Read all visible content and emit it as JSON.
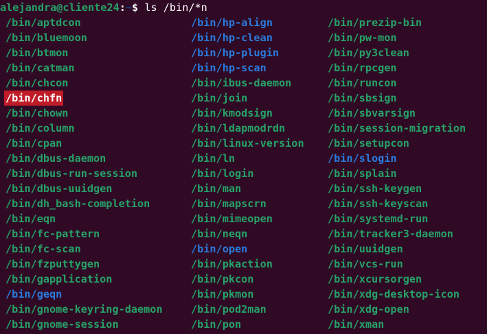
{
  "prompt": {
    "user_host": "alejandra@cliente24",
    "colon": ":",
    "path": "~",
    "dollar": "$",
    "command": " ls /bin/*n"
  },
  "columns": [
    [
      {
        "text": "/bin/aptdcon",
        "kind": "exec"
      },
      {
        "text": "/bin/bluemoon",
        "kind": "exec"
      },
      {
        "text": "/bin/btmon",
        "kind": "exec"
      },
      {
        "text": "/bin/catman",
        "kind": "exec"
      },
      {
        "text": "/bin/chcon",
        "kind": "exec"
      },
      {
        "text": "/bin/chfn",
        "kind": "setuid"
      },
      {
        "text": "/bin/chown",
        "kind": "exec"
      },
      {
        "text": "/bin/column",
        "kind": "exec"
      },
      {
        "text": "/bin/cpan",
        "kind": "exec"
      },
      {
        "text": "/bin/dbus-daemon",
        "kind": "exec"
      },
      {
        "text": "/bin/dbus-run-session",
        "kind": "exec"
      },
      {
        "text": "/bin/dbus-uuidgen",
        "kind": "exec"
      },
      {
        "text": "/bin/dh_bash-completion",
        "kind": "exec"
      },
      {
        "text": "/bin/eqn",
        "kind": "exec"
      },
      {
        "text": "/bin/fc-pattern",
        "kind": "exec"
      },
      {
        "text": "/bin/fc-scan",
        "kind": "exec"
      },
      {
        "text": "/bin/fzputtygen",
        "kind": "exec"
      },
      {
        "text": "/bin/gapplication",
        "kind": "exec"
      },
      {
        "text": "/bin/geqn",
        "kind": "link"
      },
      {
        "text": "/bin/gnome-keyring-daemon",
        "kind": "exec"
      },
      {
        "text": "/bin/gnome-session",
        "kind": "exec"
      }
    ],
    [
      {
        "text": "/bin/hp-align",
        "kind": "link"
      },
      {
        "text": "/bin/hp-clean",
        "kind": "link"
      },
      {
        "text": "/bin/hp-plugin",
        "kind": "link"
      },
      {
        "text": "/bin/hp-scan",
        "kind": "link"
      },
      {
        "text": "/bin/ibus-daemon",
        "kind": "exec"
      },
      {
        "text": "/bin/join",
        "kind": "exec"
      },
      {
        "text": "/bin/kmodsign",
        "kind": "exec"
      },
      {
        "text": "/bin/ldapmodrdn",
        "kind": "exec"
      },
      {
        "text": "/bin/linux-version",
        "kind": "exec"
      },
      {
        "text": "/bin/ln",
        "kind": "exec"
      },
      {
        "text": "/bin/login",
        "kind": "exec"
      },
      {
        "text": "/bin/man",
        "kind": "exec"
      },
      {
        "text": "/bin/mapscrn",
        "kind": "exec"
      },
      {
        "text": "/bin/mimeopen",
        "kind": "exec"
      },
      {
        "text": "/bin/neqn",
        "kind": "exec"
      },
      {
        "text": "/bin/open",
        "kind": "link"
      },
      {
        "text": "/bin/pkaction",
        "kind": "exec"
      },
      {
        "text": "/bin/pkcon",
        "kind": "exec"
      },
      {
        "text": "/bin/pkmon",
        "kind": "exec"
      },
      {
        "text": "/bin/pod2man",
        "kind": "exec"
      },
      {
        "text": "/bin/pon",
        "kind": "exec"
      }
    ],
    [
      {
        "text": "/bin/prezip-bin",
        "kind": "exec"
      },
      {
        "text": "/bin/pw-mon",
        "kind": "exec"
      },
      {
        "text": "/bin/py3clean",
        "kind": "exec"
      },
      {
        "text": "/bin/rpcgen",
        "kind": "exec"
      },
      {
        "text": "/bin/runcon",
        "kind": "exec"
      },
      {
        "text": "/bin/sbsign",
        "kind": "exec"
      },
      {
        "text": "/bin/sbvarsign",
        "kind": "exec"
      },
      {
        "text": "/bin/session-migration",
        "kind": "exec"
      },
      {
        "text": "/bin/setupcon",
        "kind": "exec"
      },
      {
        "text": "/bin/slogin",
        "kind": "link"
      },
      {
        "text": "/bin/splain",
        "kind": "exec"
      },
      {
        "text": "/bin/ssh-keygen",
        "kind": "exec"
      },
      {
        "text": "/bin/ssh-keyscan",
        "kind": "exec"
      },
      {
        "text": "/bin/systemd-run",
        "kind": "exec"
      },
      {
        "text": "/bin/tracker3-daemon",
        "kind": "exec"
      },
      {
        "text": "/bin/uuidgen",
        "kind": "exec"
      },
      {
        "text": "/bin/vcs-run",
        "kind": "exec"
      },
      {
        "text": "/bin/xcursorgen",
        "kind": "exec"
      },
      {
        "text": "/bin/xdg-desktop-icon",
        "kind": "exec"
      },
      {
        "text": "/bin/xdg-open",
        "kind": "exec"
      },
      {
        "text": "/bin/xman",
        "kind": "exec"
      }
    ]
  ],
  "colors": {
    "background": "#300a24",
    "exec": "#26a269",
    "link": "#2a7bde",
    "setuid_bg": "#c01c28",
    "prompt_user": "#26a269",
    "prompt_path": "#12488b"
  }
}
